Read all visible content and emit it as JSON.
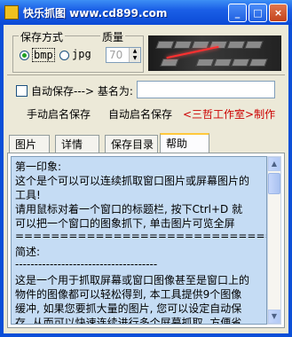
{
  "window": {
    "title": "快乐抓图 www.cd899.com",
    "minimize_glyph": "_",
    "maximize_glyph": "□",
    "close_glyph": "×",
    "app_icon": "app-icon"
  },
  "format_group": {
    "legend": "保存方式",
    "options": [
      {
        "label": "bmp",
        "selected": true
      },
      {
        "label": "jpg",
        "selected": false
      }
    ]
  },
  "quality": {
    "legend": "质量",
    "value": "70",
    "up_glyph": "▲",
    "down_glyph": "▼"
  },
  "auto_save": {
    "checkbox_label": "自动保存---> 基名为:",
    "checked": false,
    "basename_value": ""
  },
  "actions": {
    "manual_name_save": "手动启名保存",
    "auto_name_save": "自动启名保存",
    "credit": "<三哲工作室>制作",
    "credit_color": "#cc0000"
  },
  "tabs": [
    "图片",
    "详情",
    "保存目录",
    "帮助"
  ],
  "active_tab": "帮助",
  "help_lines": [
    "第一印象:",
    "这个是个可以可以连续抓取窗口图片或屏幕图片的",
    "工具!",
    "请用鼠标对着一个窗口的标题栏, 按下Ctrl+D 就",
    "可以把一个窗口的图象抓下, 单击图片可览全屏",
    "=================================",
    "简述:",
    "-------------------------------------",
    "这是一个用于抓取屏幕或窗口图像甚至是窗口上的",
    "物件的图像都可以轻松得到, 本工具提供9个图像",
    "缓冲, 如果您要抓大量的图片, 您可以设定自动保",
    "存, 从而可以快速连续进行多个屏幕抓取, 方便省"
  ],
  "colors": {
    "titlebar": "#0b4ad6",
    "memo_bg": "#c5dcf4",
    "tab_highlight": "#ffc83c"
  }
}
